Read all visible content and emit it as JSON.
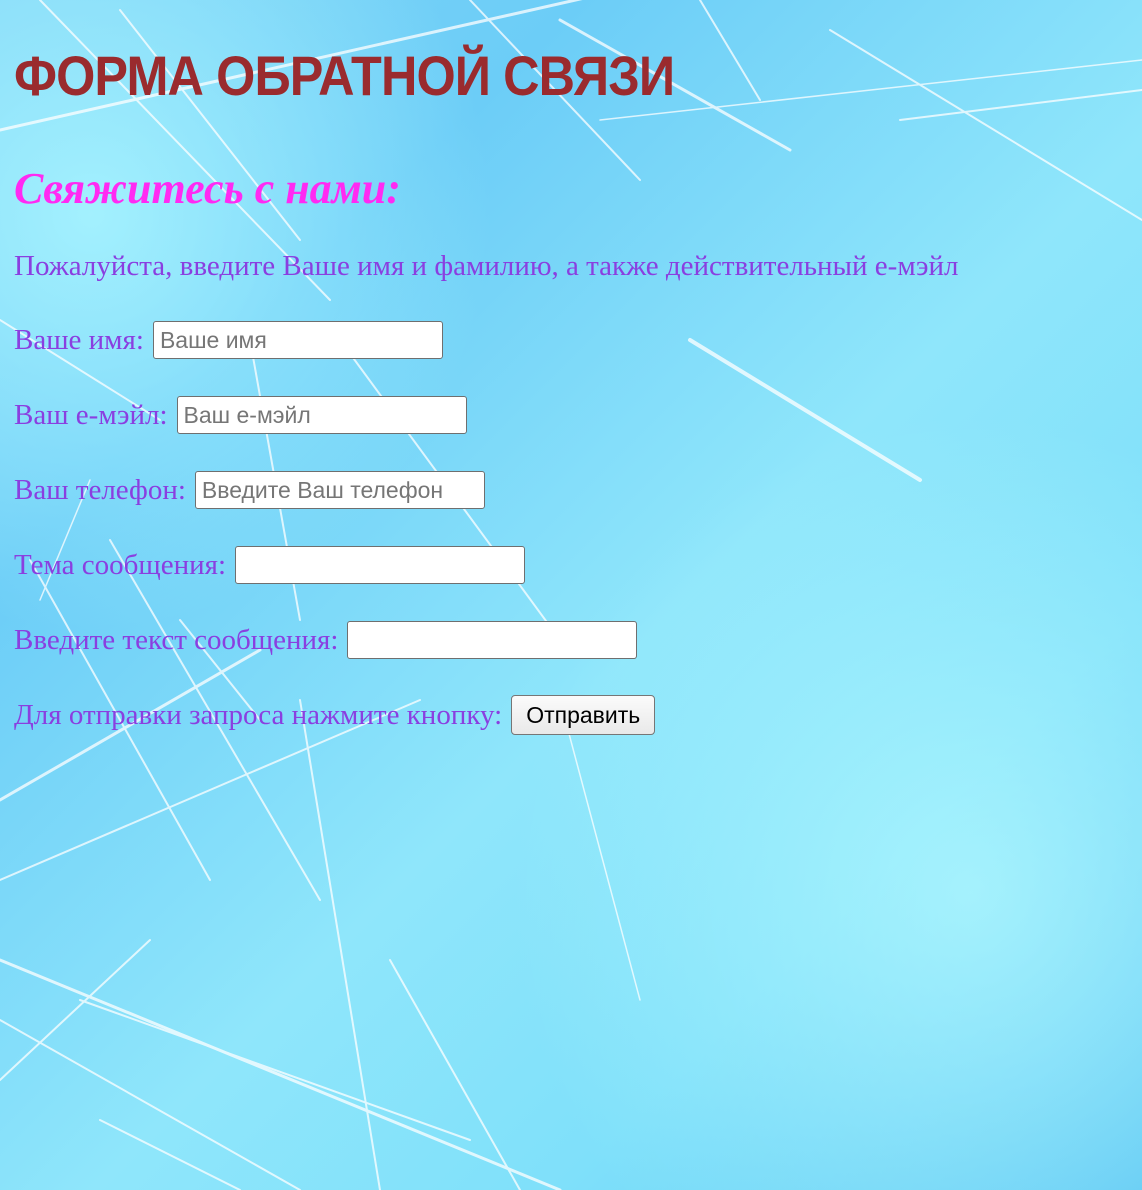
{
  "page": {
    "title": "ФОРМА ОБРАТНОЙ СВЯЗИ",
    "subtitle": "Свяжитесь с нами:",
    "intro": "Пожалуйста, введите Ваше имя и фамилию, а также действительный е-мэйл"
  },
  "form": {
    "name": {
      "label": "Ваше имя:",
      "placeholder": "Ваше имя",
      "value": ""
    },
    "email": {
      "label": "Ваш е-мэйл:",
      "placeholder": "Ваш е-мэйл",
      "value": ""
    },
    "phone": {
      "label": "Ваш телефон:",
      "placeholder": "Введите Ваш телефон",
      "value": ""
    },
    "subject": {
      "label": "Тема сообщения:",
      "placeholder": "",
      "value": ""
    },
    "message": {
      "label": "Введите текст сообщения:",
      "placeholder": "",
      "value": ""
    },
    "submit": {
      "label": "Для отправки запроса нажмите кнопку:",
      "button": "Отправить"
    }
  },
  "colors": {
    "title": "#9a2b2e",
    "subtitle": "#ff2af2",
    "text": "#8a3fe0",
    "background": "#7fd4f6"
  }
}
